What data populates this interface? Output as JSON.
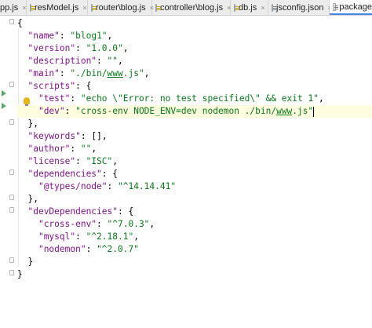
{
  "tabs": [
    {
      "label": "pp.js",
      "icon": "js-file-icon"
    },
    {
      "label": "resModel.js",
      "icon": "js-file-icon"
    },
    {
      "label": "router\\blog.js",
      "icon": "js-file-icon"
    },
    {
      "label": "controller\\blog.js",
      "icon": "js-file-icon"
    },
    {
      "label": "db.js",
      "icon": "js-file-icon"
    },
    {
      "label": "jsconfig.json",
      "icon": "json-file-icon"
    },
    {
      "label": "package.js",
      "icon": "json-file-icon"
    }
  ],
  "close_glyph": "×",
  "code": {
    "open_brace": "{",
    "name_key": "\"name\"",
    "name_val": "\"blog1\"",
    "version_key": "\"version\"",
    "version_val": "\"1.0.0\"",
    "description_key": "\"description\"",
    "description_val": "\"\"",
    "main_key": "\"main\"",
    "main_val_pre": "\"./bin/",
    "main_val_url": "www",
    "main_val_post": ".js\"",
    "scripts_key": "\"scripts\"",
    "test_key": "\"test\"",
    "test_val": "\"echo \\\"Error: no test specified\\\" && exit 1\"",
    "dev_key": "\"dev\"",
    "dev_val_pre": "\"cross-env NODE_ENV=dev nodemon ./bin/",
    "dev_val_url": "www",
    "dev_val_post": ".js\"",
    "scripts_close": "},",
    "keywords_key": "\"keywords\"",
    "keywords_val": "[]",
    "author_key": "\"author\"",
    "author_val": "\"\"",
    "license_key": "\"license\"",
    "license_val": "\"ISC\"",
    "dependencies_key": "\"dependencies\"",
    "types_node_key": "\"@types/node\"",
    "types_node_val": "\"^14.14.41\"",
    "dependencies_close": "},",
    "devdeps_key": "\"devDependencies\"",
    "cross_env_key": "\"cross-env\"",
    "cross_env_val": "\"^7.0.3\"",
    "mysql_key": "\"mysql\"",
    "mysql_val": "\"^2.18.1\"",
    "nodemon_key": "\"nodemon\"",
    "nodemon_val": "\"^2.0.7\"",
    "devdeps_close": "}",
    "close_brace": "}"
  },
  "colors": {
    "key": "#871094",
    "string": "#067d17",
    "current_line": "#fffde0",
    "tab_active_underline": "#4a88e8"
  }
}
